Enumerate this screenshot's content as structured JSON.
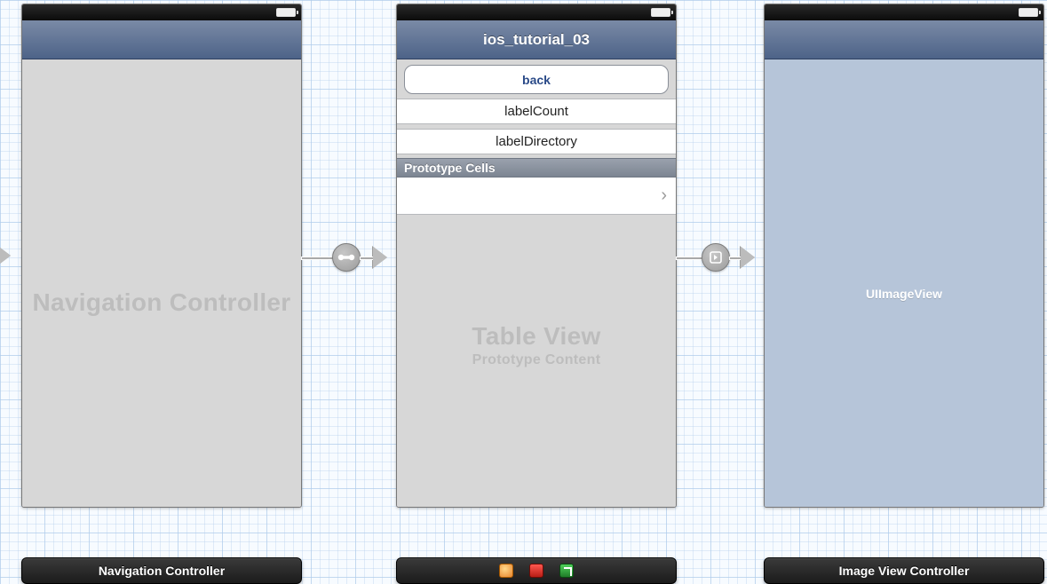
{
  "background": "storyboard-grid",
  "scenes": {
    "nav": {
      "watermark": "Navigation Controller",
      "dock_label": "Navigation Controller"
    },
    "table": {
      "nav_title": "ios_tutorial_03",
      "back_label": "back",
      "label1": "labelCount",
      "label2": "labelDirectory",
      "proto_header": "Prototype Cells",
      "watermark_title": "Table View",
      "watermark_sub": "Prototype Content"
    },
    "image": {
      "placeholder": "UIImageView",
      "dock_label": "Image View Controller"
    }
  },
  "segues": {
    "root": "root-view-controller",
    "push": "push"
  }
}
